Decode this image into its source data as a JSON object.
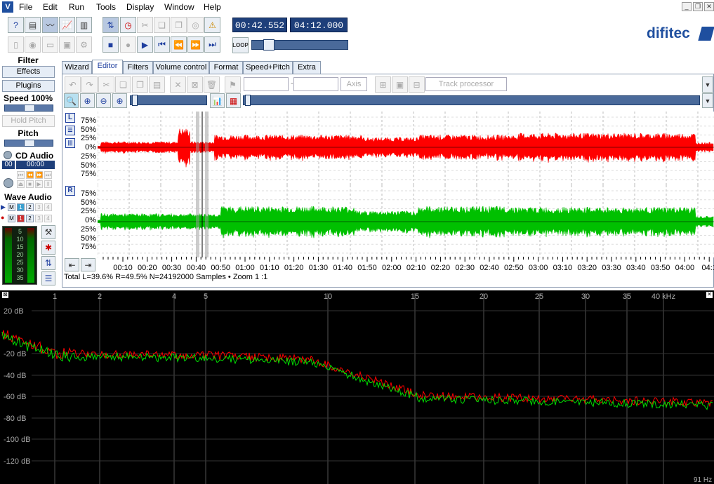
{
  "menu": [
    "File",
    "Edit",
    "Run",
    "Tools",
    "Display",
    "Window",
    "Help"
  ],
  "time": {
    "position": "00:42.552",
    "length": "04:12.000"
  },
  "brand": "difitec",
  "loop_label": "LOOP",
  "left": {
    "filter_label": "Filter",
    "effects_btn": "Effects",
    "plugins_btn": "Plugins",
    "speed_label": "Speed 100%",
    "hold_pitch": "Hold Pitch",
    "pitch_label": "Pitch",
    "cd_audio": "CD Audio",
    "cd_track": "00",
    "cd_time": "00:00",
    "wave_audio": "Wave Audio",
    "vu_scale": [
      "5",
      "10",
      "15",
      "20",
      "25",
      "30",
      "35"
    ]
  },
  "tabs": [
    "Wizard",
    "Editor",
    "Filters",
    "Volume control",
    "Format",
    "Speed+Pitch",
    "Extra"
  ],
  "editor": {
    "axis_btn": "Axis",
    "track_processor": "Track processor",
    "field_sep": "-",
    "scale": [
      "75%",
      "50%",
      "25%",
      "0%",
      "25%",
      "50%",
      "75%"
    ],
    "ch_left": "L",
    "ch_right": "R",
    "timeline": [
      "00:10",
      "00:20",
      "00:30",
      "00:40",
      "00:50",
      "01:00",
      "01:10",
      "01:20",
      "01:30",
      "01:40",
      "01:50",
      "02:00",
      "02:10",
      "02:20",
      "02:30",
      "02:40",
      "02:50",
      "03:00",
      "03:10",
      "03:20",
      "03:30",
      "03:40",
      "03:50",
      "04:00",
      "04:1"
    ],
    "status": "Total L=39.6% R=49.5% N=24192000 Samples • Zoom 1 :1"
  },
  "spectrum": {
    "db_labels": [
      "20 dB",
      "-20 dB",
      "-40 dB",
      "-60 dB",
      "-80 dB",
      "-100 dB",
      "-120 dB"
    ],
    "khz_labels": [
      "1",
      "2",
      "4",
      "5",
      "10",
      "15",
      "20",
      "25",
      "30",
      "35",
      "40 kHz"
    ],
    "resolution": "91 Hz",
    "colors": {
      "left": "#ff0000",
      "right": "#00e000",
      "grid": "#555555"
    }
  }
}
